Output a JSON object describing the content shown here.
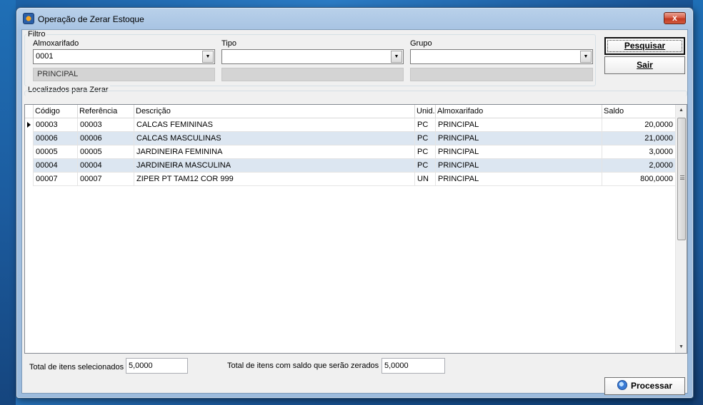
{
  "window": {
    "title": "Operação de Zerar Estoque",
    "app_icon": "app-logo-icon",
    "close_glyph": "x"
  },
  "filtro": {
    "group_label": "Filtro",
    "almoxarifado_label": "Almoxarifado",
    "almoxarifado_value": "0001",
    "almoxarifado_desc": "PRINCIPAL",
    "tipo_label": "Tipo",
    "tipo_value": "",
    "tipo_desc": "",
    "grupo_label": "Grupo",
    "grupo_value": "",
    "grupo_desc": ""
  },
  "buttons": {
    "pesquisar": "Pesquisar",
    "sair": "Sair",
    "processar": "Processar"
  },
  "localizados": {
    "group_label": "Localizados para Zerar",
    "columns": [
      "Código",
      "Referência",
      "Descrição",
      "Unid.",
      "Almoxarifado",
      "Saldo"
    ],
    "rows": [
      {
        "codigo": "00003",
        "referencia": "00003",
        "descricao": "CALCAS FEMININAS",
        "unid": "PC",
        "almoxarifado": "PRINCIPAL",
        "saldo": "20,0000"
      },
      {
        "codigo": "00006",
        "referencia": "00006",
        "descricao": "CALCAS MASCULINAS",
        "unid": "PC",
        "almoxarifado": "PRINCIPAL",
        "saldo": "21,0000"
      },
      {
        "codigo": "00005",
        "referencia": "00005",
        "descricao": "JARDINEIRA FEMININA",
        "unid": "PC",
        "almoxarifado": "PRINCIPAL",
        "saldo": "3,0000"
      },
      {
        "codigo": "00004",
        "referencia": "00004",
        "descricao": "JARDINEIRA MASCULINA",
        "unid": "PC",
        "almoxarifado": "PRINCIPAL",
        "saldo": "2,0000"
      },
      {
        "codigo": "00007",
        "referencia": "00007",
        "descricao": "ZIPER PT TAM12 COR 999",
        "unid": "UN",
        "almoxarifado": "PRINCIPAL",
        "saldo": "800,0000"
      }
    ]
  },
  "totals": {
    "selecionados_label": "Total de itens selecionados",
    "selecionados_value": "5,0000",
    "zerados_label": "Total de itens com saldo que serão zerados",
    "zerados_value": "5,0000"
  }
}
